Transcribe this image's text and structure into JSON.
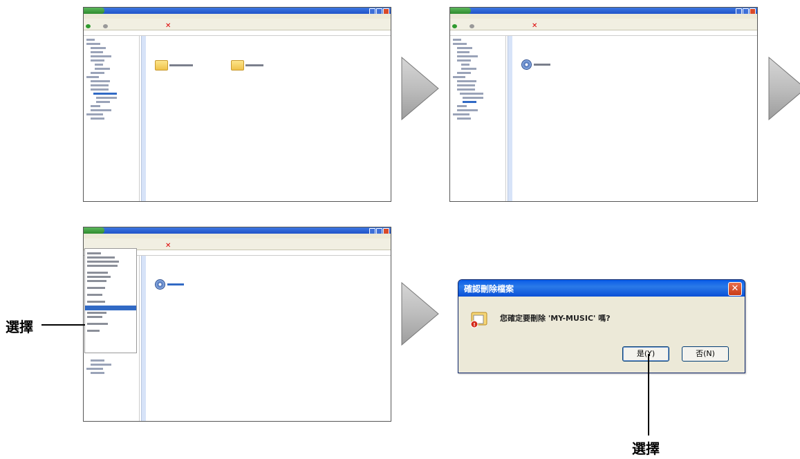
{
  "labels": {
    "select_left": "選擇",
    "select_bottom": "選擇"
  },
  "panel1": {
    "folders": [
      "WebMMonkeyPlayer",
      "MY-DATA"
    ]
  },
  "panel2": {
    "items": [
      "MY-MUSIC"
    ]
  },
  "panel3": {
    "items": [
      "MY-MUSIC"
    ]
  },
  "dialog": {
    "title": "確認刪除檔案",
    "message": "您確定要刪除 'MY-MUSIC' 嗎?",
    "yes_label": "是(Y)",
    "no_label": "否(N)"
  },
  "colors": {
    "xp_blue": "#316ac5",
    "arrow_gray": "#b9b9b9",
    "dialog_face": "#ece9d8"
  }
}
